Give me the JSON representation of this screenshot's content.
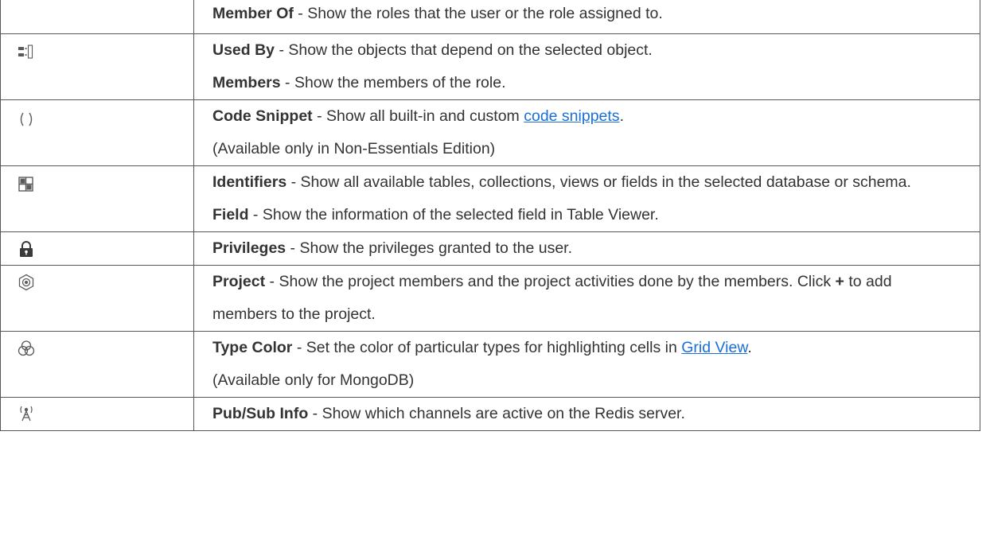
{
  "rows": [
    {
      "icon": "",
      "lines": [
        {
          "term": "Member Of",
          "text": " - Show the roles that the user or the role assigned to."
        }
      ]
    },
    {
      "icon": "used-by-icon",
      "lines": [
        {
          "term": "Used By",
          "text": " - Show the objects that depend on the selected object."
        },
        {
          "term": "Members",
          "text": " - Show the members of the role."
        }
      ]
    },
    {
      "icon": "code-snippet-icon",
      "lines": [
        {
          "term": "Code Snippet",
          "text": " - Show all built-in and custom ",
          "link": "code snippets",
          "after": "."
        },
        {
          "text": "(Available only in Non-Essentials Edition)"
        }
      ]
    },
    {
      "icon": "identifiers-icon",
      "lines": [
        {
          "term": "Identifiers",
          "text": " - Show all available tables, collections, views or fields in the selected database or schema."
        },
        {
          "term": "Field",
          "text": " - Show the information of the selected field in Table Viewer."
        }
      ]
    },
    {
      "icon": "lock-icon",
      "lines": [
        {
          "term": "Privileges",
          "text": " - Show the privileges granted to the user."
        }
      ]
    },
    {
      "icon": "project-icon",
      "lines": [
        {
          "term": "Project",
          "text": " - Show the project members and the project activities done by the members. Click ",
          "plus": "+",
          "after": " to add members to the project."
        }
      ]
    },
    {
      "icon": "type-color-icon",
      "lines": [
        {
          "term": "Type Color",
          "text": " - Set the color of particular types for highlighting cells in ",
          "link": "Grid View",
          "after": "."
        },
        {
          "text": "(Available only for MongoDB)"
        }
      ]
    },
    {
      "icon": "pubsub-icon",
      "lines": [
        {
          "term": "Pub/Sub Info",
          "text": " - Show which channels are active on the Redis server."
        }
      ]
    }
  ],
  "colors": {
    "text": "#333333",
    "link": "#1a6fdb",
    "border": "#555555",
    "icon": "#5a5a5a"
  }
}
